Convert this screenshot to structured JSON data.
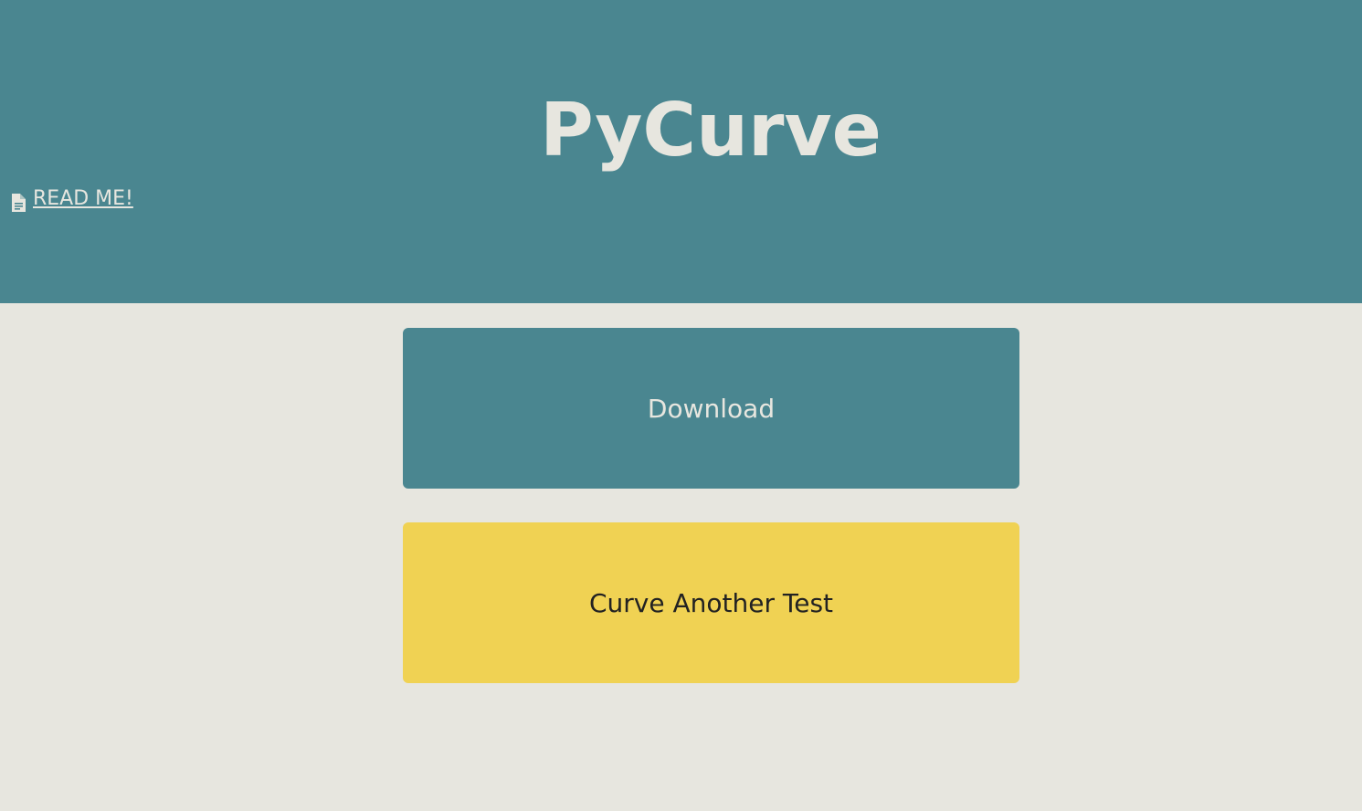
{
  "header": {
    "title": "PyCurve",
    "readme_label": "READ ME!",
    "readme_icon": "document-icon",
    "background_color": "#4a8690",
    "text_color": "#e7e6df"
  },
  "actions": {
    "download_label": "Download",
    "download_color": "#4a8690",
    "curve_another_label": "Curve Another Test",
    "curve_another_color": "#f0d253"
  },
  "page": {
    "background_color": "#e7e6df"
  }
}
